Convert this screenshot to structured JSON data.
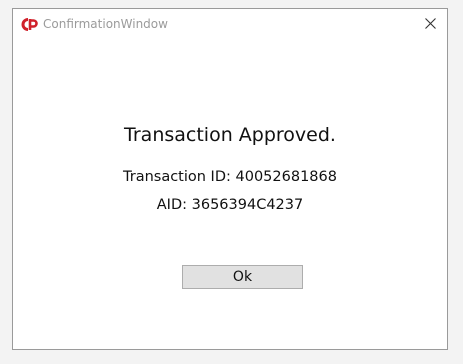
{
  "window": {
    "title": "ConfirmationWindow",
    "logo_icon": "cp-logo-icon",
    "close_icon": "close-icon"
  },
  "dialog": {
    "heading": "Transaction Approved.",
    "transaction_id_line": "Transaction ID: 40052681868",
    "aid_line": "AID: 3656394C4237",
    "ok_label": "Ok"
  },
  "colors": {
    "logo_red": "#d0202a",
    "title_gray": "#9b9b9b",
    "button_face": "#e1e1e1",
    "button_border": "#adadad"
  }
}
